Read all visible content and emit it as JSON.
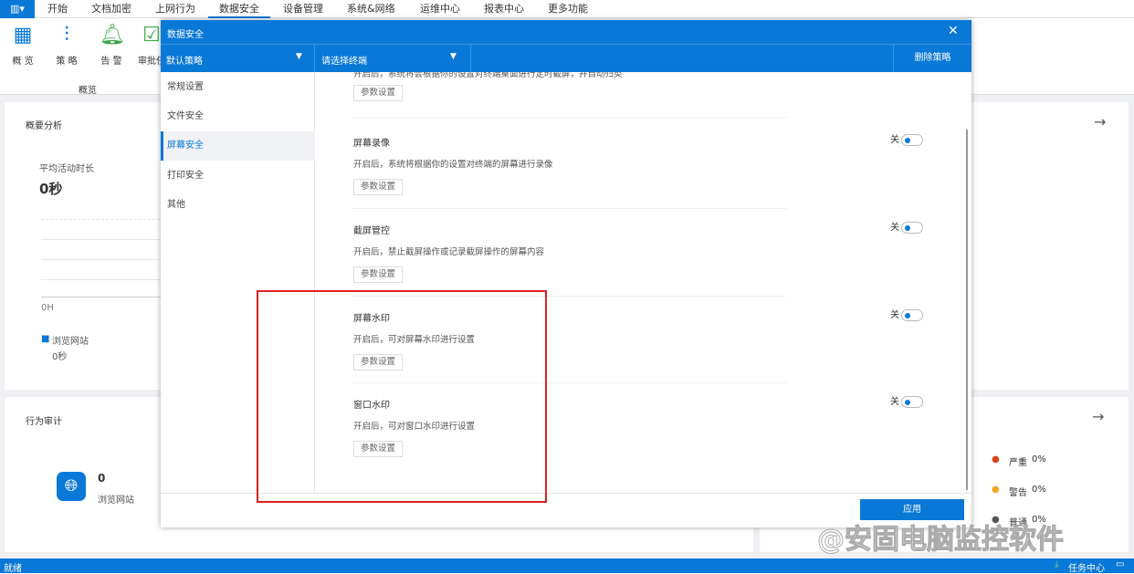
{
  "menu": {
    "items": [
      "开始",
      "文档加密",
      "上网行为",
      "数据安全",
      "设备管理",
      "系统&网络",
      "运维中心",
      "报表中心",
      "更多功能"
    ],
    "active": "数据安全"
  },
  "toolbar": {
    "items": [
      "概 览",
      "策 略",
      "告 警",
      "审批任"
    ],
    "group_label": "概览"
  },
  "overview": {
    "title": "概要分析",
    "avg_label": "平均活动时长",
    "avg_value": "0秒",
    "axis_label": "0H",
    "legend": "浏览网站",
    "legend_value": "0秒"
  },
  "audit": {
    "title": "行为审计",
    "count": "0",
    "label": "浏览网站"
  },
  "alerts": {
    "items": [
      {
        "label": "严重",
        "value": "0%",
        "color": "#d9441c"
      },
      {
        "label": "警告",
        "value": "0%",
        "color": "#f5a623"
      },
      {
        "label": "普通",
        "value": "0%",
        "color": "#555555"
      }
    ]
  },
  "status": {
    "left": "就绪",
    "task": "任务中心"
  },
  "dialog": {
    "title": "数据安全",
    "policy": "默认策略",
    "terminal": "请选择终端",
    "delete": "删除策略",
    "nav": [
      "常规设置",
      "文件安全",
      "屏幕安全",
      "打印安全",
      "其他"
    ],
    "selected": "屏幕安全",
    "top_desc": "开启后，系统将会根据你的设置对终端桌面进行定时截屏，并自动归类",
    "param": "参数设置",
    "off": "关",
    "sections": [
      {
        "title": "屏幕录像",
        "desc": "开启后，系统将根据你的设置对终端的屏幕进行录像"
      },
      {
        "title": "截屏管控",
        "desc": "开启后，禁止截屏操作或记录截屏操作的屏幕内容"
      },
      {
        "title": "屏幕水印",
        "desc": "开启后，可对屏幕水印进行设置"
      },
      {
        "title": "窗口水印",
        "desc": "开启后，可对窗口水印进行设置"
      }
    ],
    "apply": "应用"
  },
  "watermark": "@安固电脑监控软件"
}
